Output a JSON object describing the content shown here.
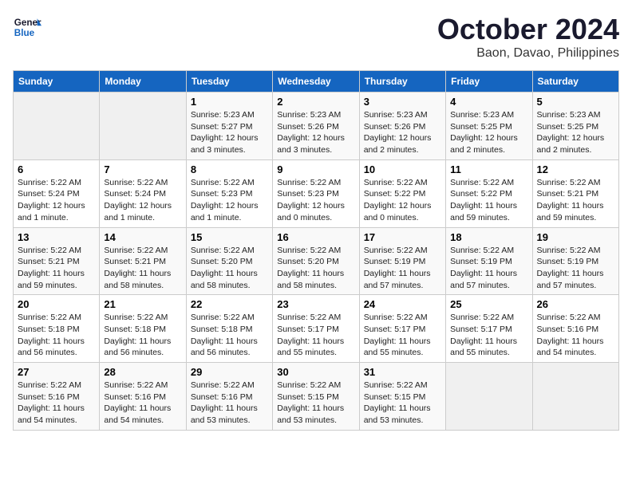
{
  "logo": {
    "line1": "General",
    "line2": "Blue"
  },
  "title": "October 2024",
  "location": "Baon, Davao, Philippines",
  "days_of_week": [
    "Sunday",
    "Monday",
    "Tuesday",
    "Wednesday",
    "Thursday",
    "Friday",
    "Saturday"
  ],
  "weeks": [
    [
      {
        "day": "",
        "info": ""
      },
      {
        "day": "",
        "info": ""
      },
      {
        "day": "1",
        "info": "Sunrise: 5:23 AM\nSunset: 5:27 PM\nDaylight: 12 hours and 3 minutes."
      },
      {
        "day": "2",
        "info": "Sunrise: 5:23 AM\nSunset: 5:26 PM\nDaylight: 12 hours and 3 minutes."
      },
      {
        "day": "3",
        "info": "Sunrise: 5:23 AM\nSunset: 5:26 PM\nDaylight: 12 hours and 2 minutes."
      },
      {
        "day": "4",
        "info": "Sunrise: 5:23 AM\nSunset: 5:25 PM\nDaylight: 12 hours and 2 minutes."
      },
      {
        "day": "5",
        "info": "Sunrise: 5:23 AM\nSunset: 5:25 PM\nDaylight: 12 hours and 2 minutes."
      }
    ],
    [
      {
        "day": "6",
        "info": "Sunrise: 5:22 AM\nSunset: 5:24 PM\nDaylight: 12 hours and 1 minute."
      },
      {
        "day": "7",
        "info": "Sunrise: 5:22 AM\nSunset: 5:24 PM\nDaylight: 12 hours and 1 minute."
      },
      {
        "day": "8",
        "info": "Sunrise: 5:22 AM\nSunset: 5:23 PM\nDaylight: 12 hours and 1 minute."
      },
      {
        "day": "9",
        "info": "Sunrise: 5:22 AM\nSunset: 5:23 PM\nDaylight: 12 hours and 0 minutes."
      },
      {
        "day": "10",
        "info": "Sunrise: 5:22 AM\nSunset: 5:22 PM\nDaylight: 12 hours and 0 minutes."
      },
      {
        "day": "11",
        "info": "Sunrise: 5:22 AM\nSunset: 5:22 PM\nDaylight: 11 hours and 59 minutes."
      },
      {
        "day": "12",
        "info": "Sunrise: 5:22 AM\nSunset: 5:21 PM\nDaylight: 11 hours and 59 minutes."
      }
    ],
    [
      {
        "day": "13",
        "info": "Sunrise: 5:22 AM\nSunset: 5:21 PM\nDaylight: 11 hours and 59 minutes."
      },
      {
        "day": "14",
        "info": "Sunrise: 5:22 AM\nSunset: 5:21 PM\nDaylight: 11 hours and 58 minutes."
      },
      {
        "day": "15",
        "info": "Sunrise: 5:22 AM\nSunset: 5:20 PM\nDaylight: 11 hours and 58 minutes."
      },
      {
        "day": "16",
        "info": "Sunrise: 5:22 AM\nSunset: 5:20 PM\nDaylight: 11 hours and 58 minutes."
      },
      {
        "day": "17",
        "info": "Sunrise: 5:22 AM\nSunset: 5:19 PM\nDaylight: 11 hours and 57 minutes."
      },
      {
        "day": "18",
        "info": "Sunrise: 5:22 AM\nSunset: 5:19 PM\nDaylight: 11 hours and 57 minutes."
      },
      {
        "day": "19",
        "info": "Sunrise: 5:22 AM\nSunset: 5:19 PM\nDaylight: 11 hours and 57 minutes."
      }
    ],
    [
      {
        "day": "20",
        "info": "Sunrise: 5:22 AM\nSunset: 5:18 PM\nDaylight: 11 hours and 56 minutes."
      },
      {
        "day": "21",
        "info": "Sunrise: 5:22 AM\nSunset: 5:18 PM\nDaylight: 11 hours and 56 minutes."
      },
      {
        "day": "22",
        "info": "Sunrise: 5:22 AM\nSunset: 5:18 PM\nDaylight: 11 hours and 56 minutes."
      },
      {
        "day": "23",
        "info": "Sunrise: 5:22 AM\nSunset: 5:17 PM\nDaylight: 11 hours and 55 minutes."
      },
      {
        "day": "24",
        "info": "Sunrise: 5:22 AM\nSunset: 5:17 PM\nDaylight: 11 hours and 55 minutes."
      },
      {
        "day": "25",
        "info": "Sunrise: 5:22 AM\nSunset: 5:17 PM\nDaylight: 11 hours and 55 minutes."
      },
      {
        "day": "26",
        "info": "Sunrise: 5:22 AM\nSunset: 5:16 PM\nDaylight: 11 hours and 54 minutes."
      }
    ],
    [
      {
        "day": "27",
        "info": "Sunrise: 5:22 AM\nSunset: 5:16 PM\nDaylight: 11 hours and 54 minutes."
      },
      {
        "day": "28",
        "info": "Sunrise: 5:22 AM\nSunset: 5:16 PM\nDaylight: 11 hours and 54 minutes."
      },
      {
        "day": "29",
        "info": "Sunrise: 5:22 AM\nSunset: 5:16 PM\nDaylight: 11 hours and 53 minutes."
      },
      {
        "day": "30",
        "info": "Sunrise: 5:22 AM\nSunset: 5:15 PM\nDaylight: 11 hours and 53 minutes."
      },
      {
        "day": "31",
        "info": "Sunrise: 5:22 AM\nSunset: 5:15 PM\nDaylight: 11 hours and 53 minutes."
      },
      {
        "day": "",
        "info": ""
      },
      {
        "day": "",
        "info": ""
      }
    ]
  ]
}
